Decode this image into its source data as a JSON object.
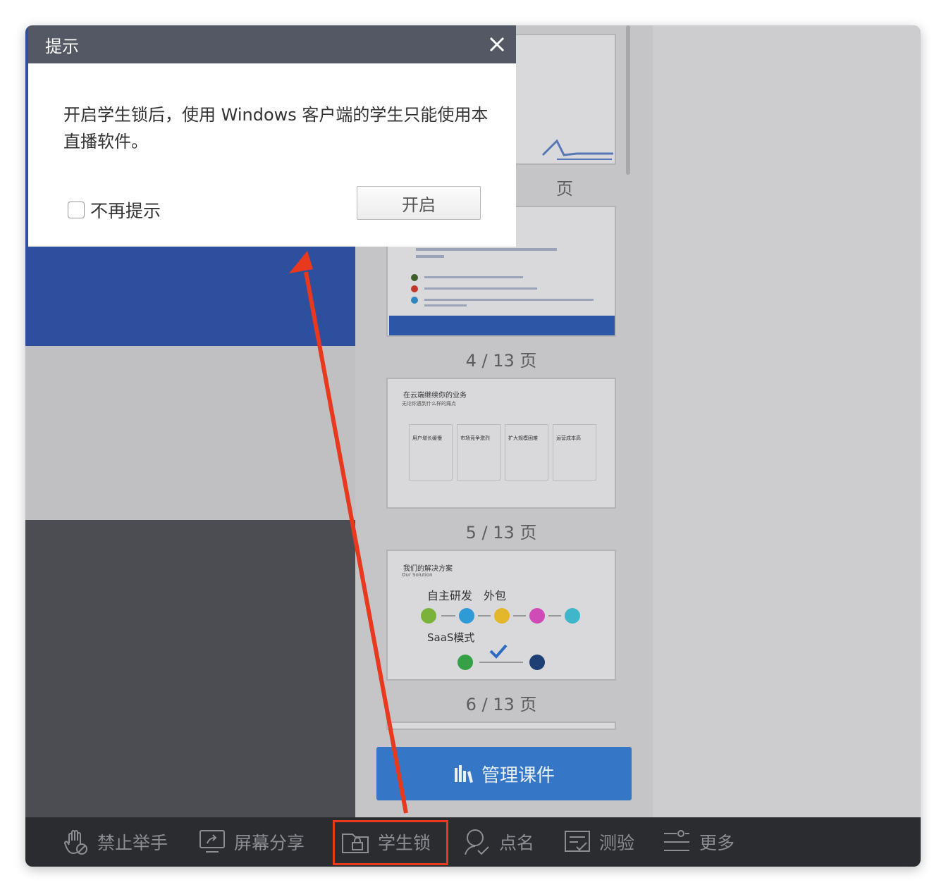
{
  "dialog": {
    "title": "提示",
    "message": "开启学生锁后，使用 Windows 客户端的学生只能使用本直播软件。",
    "checkbox_label": "不再提示",
    "open_button": "开启"
  },
  "thumbnails": [
    {
      "label": "页"
    },
    {
      "label": "4 / 13 页"
    },
    {
      "label": "5 / 13 页",
      "title": "在云端继续你的业务",
      "subtitle": "无论你遇到什么样的痛点",
      "cards": [
        "用户增长缓慢",
        "市场竞争激烈",
        "扩大规模困难",
        "运营成本高"
      ]
    },
    {
      "label": "6 / 13 页",
      "title": "我们的解决方案",
      "subtitle": "Our Solution",
      "row1": "自主研发",
      "row1b": "外包",
      "row2": "SaaS模式"
    }
  ],
  "manage_button": "管理课件",
  "toolbar": {
    "items": [
      {
        "label": "禁止举手",
        "icon": "hand-icon"
      },
      {
        "label": "屏幕分享",
        "icon": "screen-share-icon"
      },
      {
        "label": "学生锁",
        "icon": "lock-icon"
      },
      {
        "label": "点名",
        "icon": "roll-call-icon"
      },
      {
        "label": "测验",
        "icon": "quiz-icon"
      },
      {
        "label": "更多",
        "icon": "more-icon"
      }
    ]
  },
  "colors": {
    "accent": "#3577c6",
    "annotation": "#e8391f",
    "toolbar": "#2b2c30",
    "dialog_title": "#545865"
  }
}
